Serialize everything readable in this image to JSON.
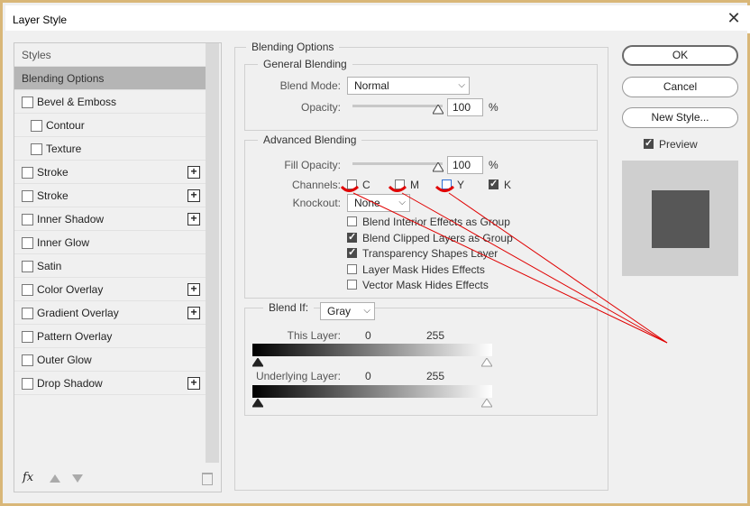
{
  "window": {
    "title": "Layer Style",
    "close_glyph": "✕"
  },
  "styles_panel": {
    "header": "Styles",
    "items": [
      {
        "label": "Blending Options",
        "selected": true,
        "checkbox": false,
        "plus": false,
        "indent": false
      },
      {
        "label": "Bevel & Emboss",
        "checkbox": true,
        "plus": false,
        "indent": false
      },
      {
        "label": "Contour",
        "checkbox": true,
        "plus": false,
        "indent": true
      },
      {
        "label": "Texture",
        "checkbox": true,
        "plus": false,
        "indent": true
      },
      {
        "label": "Stroke",
        "checkbox": true,
        "plus": true,
        "indent": false
      },
      {
        "label": "Stroke",
        "checkbox": true,
        "plus": true,
        "indent": false
      },
      {
        "label": "Inner Shadow",
        "checkbox": true,
        "plus": true,
        "indent": false
      },
      {
        "label": "Inner Glow",
        "checkbox": true,
        "plus": false,
        "indent": false
      },
      {
        "label": "Satin",
        "checkbox": true,
        "plus": false,
        "indent": false
      },
      {
        "label": "Color Overlay",
        "checkbox": true,
        "plus": true,
        "indent": false
      },
      {
        "label": "Gradient Overlay",
        "checkbox": true,
        "plus": true,
        "indent": false
      },
      {
        "label": "Pattern Overlay",
        "checkbox": true,
        "plus": false,
        "indent": false
      },
      {
        "label": "Outer Glow",
        "checkbox": true,
        "plus": false,
        "indent": false
      },
      {
        "label": "Drop Shadow",
        "checkbox": true,
        "plus": true,
        "indent": false
      }
    ],
    "plus_glyph": "+",
    "fx_label": "fx"
  },
  "blending_options": {
    "title": "Blending Options",
    "general": {
      "title": "General Blending",
      "blend_mode_label": "Blend Mode:",
      "blend_mode_value": "Normal",
      "opacity_label": "Opacity:",
      "opacity_value": "100",
      "percent": "%"
    },
    "advanced": {
      "title": "Advanced Blending",
      "fill_opacity_label": "Fill Opacity:",
      "fill_opacity_value": "100",
      "percent": "%",
      "channels_label": "Channels:",
      "channels": [
        {
          "label": "C",
          "checked": false
        },
        {
          "label": "M",
          "checked": false
        },
        {
          "label": "Y",
          "checked": false
        },
        {
          "label": "K",
          "checked": true
        }
      ],
      "knockout_label": "Knockout:",
      "knockout_value": "None",
      "options": [
        {
          "label": "Blend Interior Effects as Group",
          "checked": false
        },
        {
          "label": "Blend Clipped Layers as Group",
          "checked": true
        },
        {
          "label": "Transparency Shapes Layer",
          "checked": true
        },
        {
          "label": "Layer Mask Hides Effects",
          "checked": false
        },
        {
          "label": "Vector Mask Hides Effects",
          "checked": false
        }
      ]
    },
    "blend_if": {
      "label": "Blend If:",
      "value": "Gray",
      "this_layer_label": "This Layer:",
      "this_layer_min": "0",
      "this_layer_max": "255",
      "underlying_label": "Underlying Layer:",
      "underlying_min": "0",
      "underlying_max": "255"
    }
  },
  "buttons": {
    "ok": "OK",
    "cancel": "Cancel",
    "new_style": "New Style...",
    "preview_label": "Preview",
    "preview_checked": true
  },
  "colors": {
    "annotation": "#e00000",
    "frame": "#d9b778",
    "selected_row": "#b5b5b5",
    "preview_swatch": "#575757"
  }
}
